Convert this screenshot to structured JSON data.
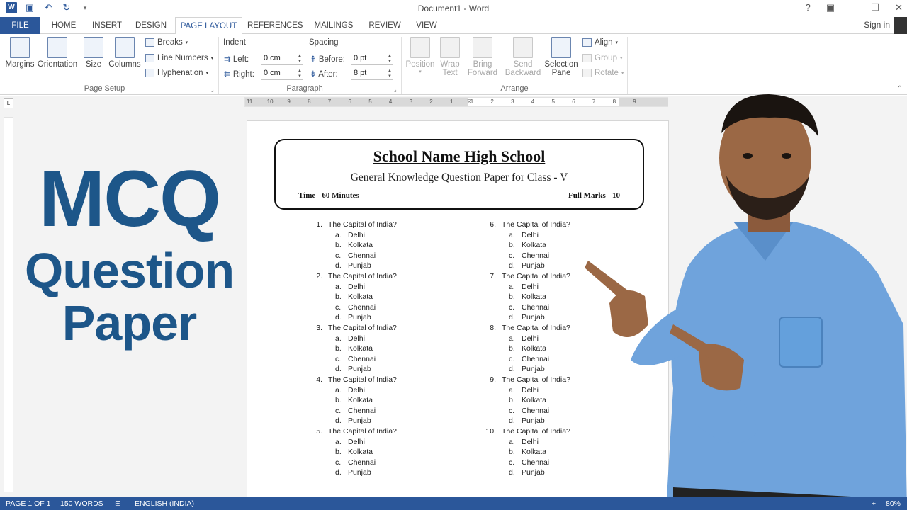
{
  "window": {
    "title": "Document1 - Word",
    "controls": [
      "?",
      "▣",
      "–",
      "❐",
      "✕"
    ],
    "signin": "Sign in"
  },
  "tabs": [
    "FILE",
    "HOME",
    "INSERT",
    "DESIGN",
    "PAGE LAYOUT",
    "REFERENCES",
    "MAILINGS",
    "REVIEW",
    "VIEW"
  ],
  "ribbon": {
    "page_setup": {
      "label": "Page Setup",
      "big_buttons": [
        "Margins",
        "Orientation",
        "Size",
        "Columns"
      ],
      "small_buttons": [
        "Breaks",
        "Line Numbers",
        "Hyphenation"
      ]
    },
    "paragraph": {
      "label": "Paragraph",
      "indent_title": "Indent",
      "spacing_title": "Spacing",
      "left_label": "Left:",
      "left_value": "0 cm",
      "right_label": "Right:",
      "right_value": "0 cm",
      "before_label": "Before:",
      "before_value": "0 pt",
      "after_label": "After:",
      "after_value": "8 pt"
    },
    "arrange": {
      "label": "Arrange",
      "position": [
        "Position",
        ""
      ],
      "wrap": [
        "Wrap",
        "Text"
      ],
      "bring": [
        "Bring",
        "Forward"
      ],
      "send": [
        "Send",
        "Backward"
      ],
      "selection": [
        "Selection",
        "Pane"
      ],
      "small_buttons": [
        "Align",
        "Group",
        "Rotate"
      ]
    }
  },
  "ruler": {
    "tab_selector": "L",
    "marks": [
      "11",
      "10",
      "9",
      "8",
      "7",
      "6",
      "5",
      "4",
      "3",
      "2",
      "1",
      "1",
      "2",
      "3",
      "4",
      "5",
      "6",
      "7",
      "8",
      "9"
    ]
  },
  "banner": {
    "line1": "MCQ",
    "line2": "Question",
    "line3": "Paper"
  },
  "document": {
    "school": "School Name High School",
    "subtitle": "General Knowledge Question Paper for Class - V",
    "time": "Time - 60 Minutes",
    "marks": "Full Marks - 10",
    "questions": [
      {
        "num": "1.",
        "text": "The Capital of India?",
        "options": [
          [
            "a.",
            "Delhi"
          ],
          [
            "b.",
            "Kolkata"
          ],
          [
            "c.",
            "Chennai"
          ],
          [
            "d.",
            "Punjab"
          ]
        ]
      },
      {
        "num": "2.",
        "text": "The Capital of India?",
        "options": [
          [
            "a.",
            "Delhi"
          ],
          [
            "b.",
            "Kolkata"
          ],
          [
            "c.",
            "Chennai"
          ],
          [
            "d.",
            "Punjab"
          ]
        ]
      },
      {
        "num": "3.",
        "text": "The Capital of India?",
        "options": [
          [
            "a.",
            "Delhi"
          ],
          [
            "b.",
            "Kolkata"
          ],
          [
            "c.",
            "Chennai"
          ],
          [
            "d.",
            "Punjab"
          ]
        ]
      },
      {
        "num": "4.",
        "text": "The Capital of India?",
        "options": [
          [
            "a.",
            "Delhi"
          ],
          [
            "b.",
            "Kolkata"
          ],
          [
            "c.",
            "Chennai"
          ],
          [
            "d.",
            "Punjab"
          ]
        ]
      },
      {
        "num": "5.",
        "text": "The Capital of India?",
        "options": [
          [
            "a.",
            "Delhi"
          ],
          [
            "b.",
            "Kolkata"
          ],
          [
            "c.",
            "Chennai"
          ],
          [
            "d.",
            "Punjab"
          ]
        ]
      },
      {
        "num": "6.",
        "text": "The Capital of India?",
        "options": [
          [
            "a.",
            "Delhi"
          ],
          [
            "b.",
            "Kolkata"
          ],
          [
            "c.",
            "Chennai"
          ],
          [
            "d.",
            "Punjab"
          ]
        ]
      },
      {
        "num": "7.",
        "text": "The Capital of India?",
        "options": [
          [
            "a.",
            "Delhi"
          ],
          [
            "b.",
            "Kolkata"
          ],
          [
            "c.",
            "Chennai"
          ],
          [
            "d.",
            "Punjab"
          ]
        ]
      },
      {
        "num": "8.",
        "text": "The Capital of India?",
        "options": [
          [
            "a.",
            "Delhi"
          ],
          [
            "b.",
            "Kolkata"
          ],
          [
            "c.",
            "Chennai"
          ],
          [
            "d.",
            "Punjab"
          ]
        ]
      },
      {
        "num": "9.",
        "text": "The Capital of India?",
        "options": [
          [
            "a.",
            "Delhi"
          ],
          [
            "b.",
            "Kolkata"
          ],
          [
            "c.",
            "Chennai"
          ],
          [
            "d.",
            "Punjab"
          ]
        ]
      },
      {
        "num": "10.",
        "text": "The Capital of India?",
        "options": [
          [
            "a.",
            "Delhi"
          ],
          [
            "b.",
            "Kolkata"
          ],
          [
            "c.",
            "Chennai"
          ],
          [
            "d.",
            "Punjab"
          ]
        ]
      }
    ]
  },
  "status": {
    "page": "PAGE 1 OF 1",
    "words": "150 WORDS",
    "language": "ENGLISH (INDIA)",
    "zoom": "80%",
    "zoom_plus": "+"
  },
  "colors": {
    "word_blue": "#2b579a",
    "banner_blue": "#1d5689",
    "shirt_blue": "#6fa3dc"
  }
}
